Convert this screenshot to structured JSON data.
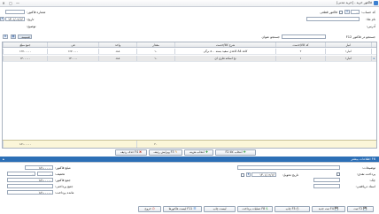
{
  "window": {
    "title": "فاکتور خرید - [خرید مدنی]",
    "minimize": "—",
    "maximize": "▢",
    "close": "✕"
  },
  "header": {
    "account_label": "کد حساب:",
    "account_code": "۰",
    "tax_invoice_label": "فاکتور قطعی",
    "tax_invoice_value": "۱",
    "name_label": "نام ملا:",
    "address_label": "آدرس:",
    "invoice_number_label": "شماره فاکتور:",
    "invoice_number_value": "",
    "date_label": "تاریخ:",
    "date_value": "۱۴۰۱/۰۲/۱۶",
    "description_label": "توضیح:"
  },
  "search": {
    "label": "جستجو در فاکتور F12",
    "field_label": "جستجو عنوان",
    "attach_label": "ضمیمه"
  },
  "table": {
    "columns": [
      "انبار",
      "کد کالا/خدمت",
      "شرح کالا/خدمت",
      "مقدار",
      "واحد",
      "فی",
      "جمع مبلغ"
    ],
    "rows": [
      [
        "انبار۱",
        "۲",
        "کاغذ A4 کاغذی سفید بسته ۵۰۰ برگی",
        "۱۰",
        "عدد",
        "۱۶۷۰۰۰۰",
        "۱۶۷۰۰۰۰۰"
      ],
      [
        "انبار۱",
        "۱",
        "نخ اسکنه فلزی ای",
        "۱۰",
        "عدد",
        "۱۴۰۰۰۰",
        "۱۴۰۰۰۰۰"
      ]
    ],
    "footer_total_qty": "۲۰",
    "footer_total_amount": "۱۸۱۰۰۰۰۰"
  },
  "grid_buttons": {
    "add": "انتخاب کالا F2",
    "select_item": "انتخاب هزینه",
    "edit_row": "F3 ویرایش ردیف",
    "delete_row": "F4 حذف ردیف"
  },
  "payment_panel": {
    "title": "F6 اطلاعات بیشتر",
    "notes_label": "توضیحات:",
    "payment_type_label": "پرداخت نقدی:",
    "check_label": "چک:",
    "check_date_label": "تاریخ تحویل:",
    "check_date_value": "۱۴۰۱/۰۲/۱۶",
    "bank_label": "اسناد دریافتنی:",
    "amount_label": "مبلغ فاکتور:",
    "amount_value": "۱۸۱۰۰۰۰۰",
    "discount_label": "تخفیف:",
    "discount_value": "۰",
    "discount_pct": "۰",
    "total_label": "جمع فاکتور:",
    "total_value": "۱۸۱۰۰۰۰۰",
    "paid_label": "جمع پرداختی:",
    "remain_label": "مانده پرداخت:",
    "remain_value": "۱۸۱۰۰۰۰۰"
  },
  "actions": {
    "save": "F2 ثبت",
    "save_new": "F4 ثبت جدید",
    "print": "F5 چاپ",
    "payment_ops": "F8 عملیات پرداخت",
    "print_list": "لیست چاپ",
    "previous": "F11 لیست فاکتورها",
    "exit": "خروج"
  },
  "colors": {
    "panel_header": "#2c6fb6",
    "footer_row": "#fbf6d9",
    "selected_row": "#e8e8e8"
  }
}
